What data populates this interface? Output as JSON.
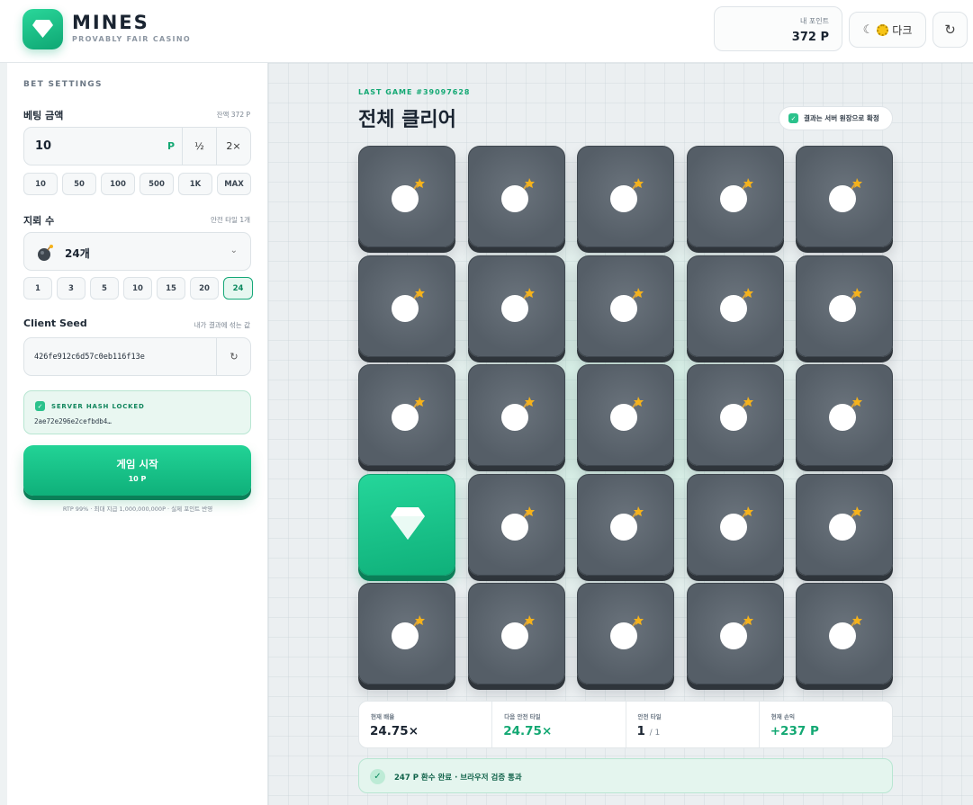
{
  "header": {
    "brand_name": "MINES",
    "brand_sub": "PROVABLY FAIR CASINO",
    "points_label": "내 포인트",
    "points_value": "372 P",
    "theme_label": "다크",
    "theme_moon": "☾",
    "refresh_glyph": "↻"
  },
  "sidebar": {
    "section_title": "BET SETTINGS",
    "bet": {
      "label": "베팅 금액",
      "hint": "잔액 372 P",
      "value": "10",
      "unit": "P",
      "half_label": "½",
      "double_label": "2×",
      "chips": [
        "10",
        "50",
        "100",
        "500",
        "1K",
        "MAX"
      ]
    },
    "mines": {
      "label": "지뢰 수",
      "hint": "안전 타일 1개",
      "value": "24개",
      "chevron": "⌄",
      "chips": [
        "1",
        "3",
        "5",
        "10",
        "15",
        "20",
        "24"
      ],
      "active_chip": "24"
    },
    "seed": {
      "label": "Client Seed",
      "hint": "내가 결과에 섞는 값",
      "value": "426fe912c6d57c0eb116f13e",
      "refresh_glyph": "↻"
    },
    "hash": {
      "title": "SERVER HASH LOCKED",
      "value": "2ae72e296e2cefbdb4…"
    },
    "start": {
      "label": "게임 시작",
      "amount": "10 P"
    },
    "rtp_note": "RTP 99% · 최대 지급 1,000,000,000P · 실제 포인트 반영"
  },
  "game": {
    "last_game": "LAST GAME #39097628",
    "result_title": "전체 클리어",
    "verify_badge": "결과는 서버 원장으로 확정",
    "tiles": [
      "mine",
      "mine",
      "mine",
      "mine",
      "mine",
      "mine",
      "mine",
      "mine",
      "mine",
      "mine",
      "mine",
      "mine",
      "mine",
      "mine",
      "mine",
      "gem",
      "mine",
      "mine",
      "mine",
      "mine",
      "mine",
      "mine",
      "mine",
      "mine",
      "mine"
    ],
    "stats": [
      {
        "label": "현재 배율",
        "value": "24.75×",
        "sub": "",
        "green": false
      },
      {
        "label": "다음 안전 타일",
        "value": "24.75×",
        "sub": "",
        "green": true
      },
      {
        "label": "안전 타일",
        "value": "1",
        "sub": "/ 1",
        "green": false
      },
      {
        "label": "현재 손익",
        "value": "+237 P",
        "sub": "",
        "green": true
      }
    ],
    "cashout_text": "247 P 환수 완료 · 브라우저 검증 통과"
  },
  "colors": {
    "accent": "#13a873",
    "tile_dark": "#555e67",
    "tile_gem": "#19c184"
  }
}
